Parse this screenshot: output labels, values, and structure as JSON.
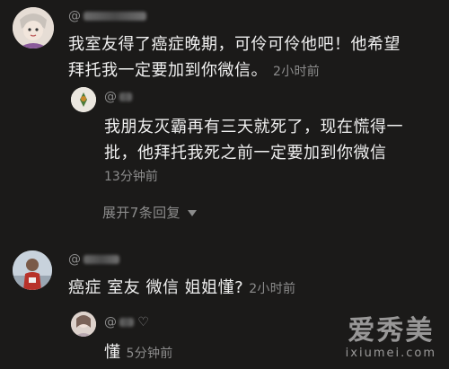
{
  "comments": [
    {
      "username_prefix": "@",
      "text_line1": "我室友得了癌症晚期，可伶可伶他吧！他希望",
      "text_line2": "拜托我一定要加到你微信。",
      "time": "2小时前",
      "replies": [
        {
          "username_prefix": "@",
          "text_line1": "我朋友灭霸再有三天就死了，现在慌得一",
          "text_line2": "批，他拜托我死之前一定要加到你微信",
          "time": "13分钟前"
        }
      ],
      "expand_label": "展开7条回复"
    },
    {
      "username_prefix": "@",
      "text_line1": "癌症 室友 微信 姐姐懂?",
      "time": "2小时前",
      "replies": [
        {
          "username_prefix": "@",
          "text_line1": "懂",
          "time": "5分钟前"
        }
      ]
    }
  ],
  "icons": {
    "heart": "heart-icon",
    "expand": "chevron-down-icon"
  },
  "watermark": {
    "cn": "爱秀美",
    "en": "ixiumei.com"
  }
}
